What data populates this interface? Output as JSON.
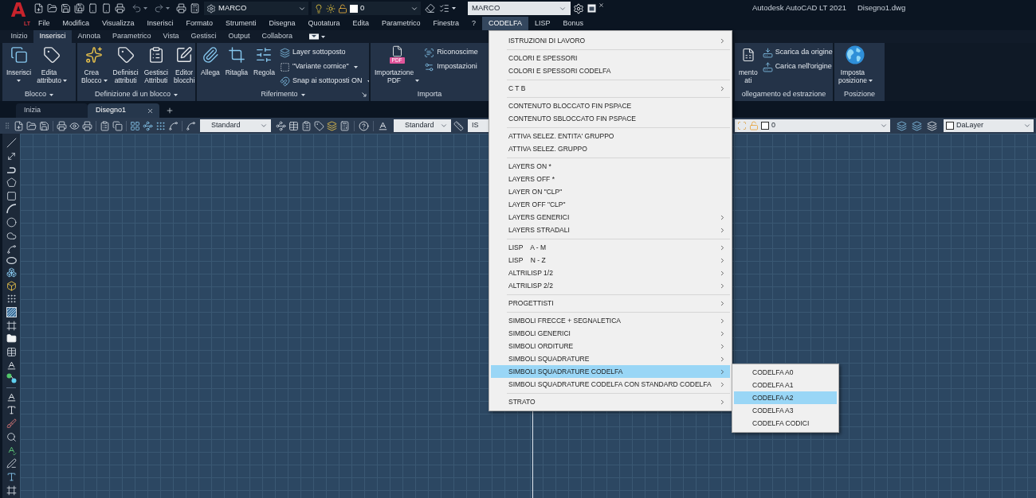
{
  "title_bar": {
    "logo": {
      "mark": "A",
      "edition": "LT"
    },
    "workspace": "MARCO",
    "layer": "0",
    "profile_field": "MARCO",
    "app_title": "Autodesk AutoCAD LT 2021",
    "document": "Disegno1.dwg"
  },
  "menu_bar": [
    {
      "label": "File",
      "selected": false
    },
    {
      "label": "Modifica",
      "selected": false
    },
    {
      "label": "Visualizza",
      "selected": false
    },
    {
      "label": "Inserisci",
      "selected": false
    },
    {
      "label": "Formato",
      "selected": false
    },
    {
      "label": "Strumenti",
      "selected": false
    },
    {
      "label": "Disegna",
      "selected": false
    },
    {
      "label": "Quotatura",
      "selected": false
    },
    {
      "label": "Edita",
      "selected": false
    },
    {
      "label": "Parametrico",
      "selected": false
    },
    {
      "label": "Finestra",
      "selected": false
    },
    {
      "label": "?",
      "selected": false
    },
    {
      "label": "CODELFA",
      "selected": true
    },
    {
      "label": "LISP",
      "selected": false
    },
    {
      "label": "Bonus",
      "selected": false
    }
  ],
  "ribbon_tabs": [
    {
      "label": "Inizio",
      "selected": false
    },
    {
      "label": "Inserisci",
      "selected": true
    },
    {
      "label": "Annota",
      "selected": false
    },
    {
      "label": "Parametrico",
      "selected": false
    },
    {
      "label": "Vista",
      "selected": false
    },
    {
      "label": "Gestisci",
      "selected": false
    },
    {
      "label": "Output",
      "selected": false
    },
    {
      "label": "Collabora",
      "selected": false
    }
  ],
  "ribbon_panels": [
    {
      "title": "Blocco",
      "title_caret": true,
      "launcher": false,
      "large_buttons": [
        {
          "label": "Inserisci",
          "kind": "split"
        },
        {
          "label": "Edita attributo",
          "kind": "dropdown"
        }
      ]
    },
    {
      "title": "Definizione di un blocco",
      "title_caret": true,
      "launcher": false,
      "large_buttons": [
        {
          "label": "Crea Blocco",
          "kind": "dropdown"
        },
        {
          "label": "Definisci attributi",
          "kind": "plain"
        },
        {
          "label": "Gestisci Attributi",
          "kind": "plain"
        },
        {
          "label": "Editor blocchi",
          "kind": "plain"
        }
      ]
    },
    {
      "title": "Riferimento",
      "title_caret": true,
      "launcher": true,
      "large_buttons": [
        {
          "label": "Allega",
          "kind": "plain"
        },
        {
          "label": "Ritaglia",
          "kind": "plain"
        },
        {
          "label": "Regola",
          "kind": "plain"
        }
      ],
      "small_buttons": [
        {
          "label": "Layer sottoposto",
          "kind": "plain"
        },
        {
          "label": "\"Variante cornice\"",
          "kind": "dropdown"
        },
        {
          "label": "Snap ai sottoposti ON",
          "kind": "dropdown"
        }
      ]
    },
    {
      "title": "Importa",
      "title_caret": false,
      "launcher": false,
      "large_buttons": [
        {
          "label": "Importazione PDF",
          "kind": "dropdown",
          "badge": "PDF"
        }
      ],
      "small_buttons": [
        {
          "label": "Riconoscime",
          "kind": "plain"
        },
        {
          "label": "Impostazioni",
          "kind": "plain"
        }
      ]
    },
    {
      "title": "ollegamento ed estrazione",
      "title_caret": false,
      "launcher": false,
      "large_buttons": [
        {
          "label": "mento ati",
          "kind": "plain"
        }
      ],
      "small_buttons": [
        {
          "label": "Scarica da origine",
          "kind": "plain"
        },
        {
          "label": "Carica nell'origine",
          "kind": "plain"
        }
      ]
    },
    {
      "title": "Posizione",
      "title_caret": false,
      "launcher": false,
      "large_buttons": [
        {
          "label": "Imposta posizione",
          "kind": "dropdown"
        }
      ]
    }
  ],
  "file_tabs": [
    {
      "label": "Inizia",
      "selected": false
    },
    {
      "label": "Disegno1",
      "selected": true
    }
  ],
  "toolbar": {
    "style_field_1": "Standard",
    "style_field_2": "Standard",
    "style_field_3": "IS",
    "layer_field": "0",
    "property_field": "DaLayer"
  },
  "codelfa_menu": {
    "groups": [
      {
        "items": [
          {
            "label": "ISTRUZIONI DI LAVORO",
            "submenu": true,
            "selected": false
          }
        ]
      },
      {
        "items": [
          {
            "label": "COLORI E SPESSORI",
            "submenu": false,
            "selected": false
          },
          {
            "label": "COLORI E SPESSORI CODELFA",
            "submenu": false,
            "selected": false
          }
        ]
      },
      {
        "items": [
          {
            "label": "C T B",
            "submenu": true,
            "selected": false
          }
        ]
      },
      {
        "items": [
          {
            "label": "CONTENUTO BLOCCATO FIN PSPACE",
            "submenu": false,
            "selected": false
          },
          {
            "label": "CONTENUTO SBLOCCATO FIN PSPACE",
            "submenu": false,
            "selected": false
          }
        ]
      },
      {
        "items": [
          {
            "label": "ATTIVA SELEZ. ENTITA' GRUPPO",
            "submenu": false,
            "selected": false
          },
          {
            "label": "ATTIVA SELEZ. GRUPPO",
            "submenu": false,
            "selected": false
          }
        ]
      },
      {
        "items": [
          {
            "label": "LAYERS ON *",
            "submenu": false,
            "selected": false
          },
          {
            "label": "LAYERS OFF *",
            "submenu": false,
            "selected": false
          },
          {
            "label": "LAYER ON \"CLP\"",
            "submenu": false,
            "selected": false
          },
          {
            "label": "LAYER OFF \"CLP\"",
            "submenu": false,
            "selected": false
          },
          {
            "label": "LAYERS GENERICI",
            "submenu": true,
            "selected": false
          },
          {
            "label": "LAYERS STRADALI",
            "submenu": true,
            "selected": false
          }
        ]
      },
      {
        "items": [
          {
            "label": "LISP    A - M",
            "submenu": true,
            "selected": false
          },
          {
            "label": "LISP    N - Z",
            "submenu": true,
            "selected": false
          },
          {
            "label": "ALTRILISP 1/2",
            "submenu": true,
            "selected": false
          },
          {
            "label": "ALTRILISP 2/2",
            "submenu": true,
            "selected": false
          }
        ]
      },
      {
        "items": [
          {
            "label": "PROGETTISTI",
            "submenu": true,
            "selected": false
          }
        ]
      },
      {
        "items": [
          {
            "label": "SIMBOLI FRECCE + SEGNALETICA",
            "submenu": true,
            "selected": false
          },
          {
            "label": "SIMBOLI GENERICI",
            "submenu": true,
            "selected": false
          },
          {
            "label": "SIMBOLI ORDITURE",
            "submenu": true,
            "selected": false
          },
          {
            "label": "SIMBOLI SQUADRATURE",
            "submenu": true,
            "selected": false
          },
          {
            "label": "SIMBOLI SQUADRATURE CODELFA",
            "submenu": true,
            "selected": true
          },
          {
            "label": "SIMBOLI SQUADRATURE CODELFA CON STANDARD CODELFA",
            "submenu": true,
            "selected": false
          }
        ]
      },
      {
        "items": [
          {
            "label": "STRATO",
            "submenu": true,
            "selected": false
          }
        ]
      }
    ]
  },
  "codelfa_submenu": {
    "items": [
      {
        "label": "CODELFA A0",
        "selected": false
      },
      {
        "label": "CODELFA A1",
        "selected": false
      },
      {
        "label": "CODELFA A2",
        "selected": true
      },
      {
        "label": "CODELFA A3",
        "selected": false
      },
      {
        "label": "CODELFA CODICI",
        "selected": false
      }
    ]
  }
}
